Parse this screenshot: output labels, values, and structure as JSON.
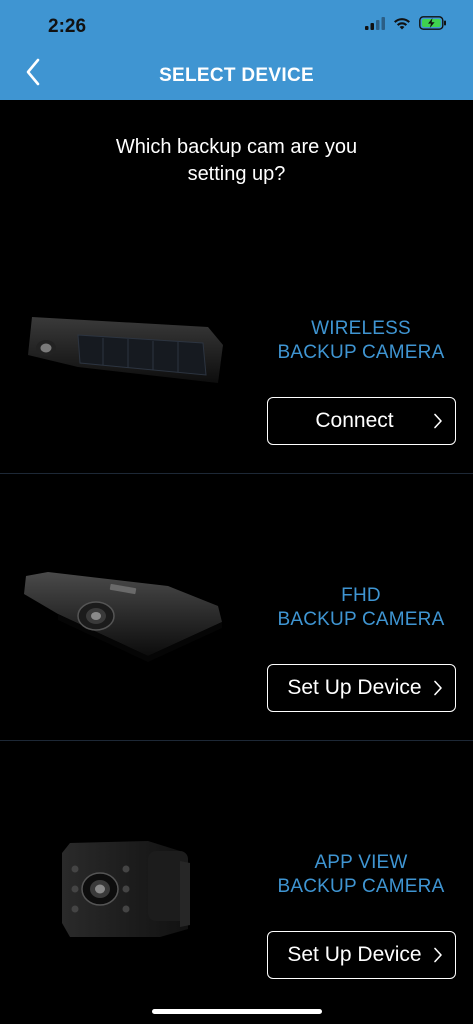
{
  "status_bar": {
    "time": "2:26"
  },
  "header": {
    "title": "SELECT DEVICE"
  },
  "question": {
    "line1": "Which backup cam are you",
    "line2": "setting up?"
  },
  "devices": [
    {
      "title_line1": "WIRELESS",
      "title_line2": "BACKUP CAMERA",
      "button_label": "Connect"
    },
    {
      "title_line1": "FHD",
      "title_line2": "BACKUP CAMERA",
      "button_label": "Set Up Device"
    },
    {
      "title_line1": "APP VIEW",
      "title_line2": "BACKUP CAMERA",
      "button_label": "Set Up Device"
    }
  ],
  "colors": {
    "header_bg": "#3f95d2",
    "title_accent": "#3f95d2",
    "background": "#000000"
  },
  "icons": {
    "back": "chevron-left-icon",
    "button": "chevron-right-icon"
  }
}
